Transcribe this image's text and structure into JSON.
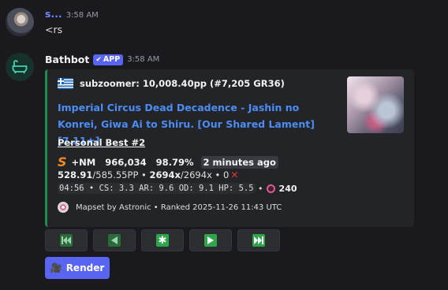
{
  "message1": {
    "username": "s...",
    "time": "3:58 AM",
    "text": "<rs"
  },
  "message2": {
    "username": "Bathbot",
    "badge": "APP",
    "time": "3:58 AM"
  },
  "embed": {
    "accent_color": "#1f8b4c",
    "author": "subzoomer: 10,008.40pp (#7,205 GR36)",
    "title": "Imperial Circus Dead Decadence - Jashin no Konrei, Giwa Ai to Shiru. [Our Shared Lament] [7.11★]",
    "personal_best": "Personal Best #2",
    "grade": "S",
    "mods": "+NM",
    "score": "966,034",
    "accuracy": "98.79%",
    "time_ago": "2 minutes ago",
    "pp_value": "528.91",
    "pp_max": "/585.55PP",
    "combo": "2694x",
    "max_combo": "/2694x",
    "misses": "0",
    "map_stats": "04:56 • CS: 3.3 AR: 9.6 OD: 9.1 HP: 5.5",
    "circle_count": "240",
    "footer": "Mapset by Astronic • Ranked 2025-11-26 11:43 UTC"
  },
  "buttons": [
    {
      "name": "first-page",
      "icon": "skip-back-icon"
    },
    {
      "name": "previous-page",
      "icon": "play-left-icon"
    },
    {
      "name": "jump-page",
      "icon": "asterisk-icon"
    },
    {
      "name": "next-page",
      "icon": "play-right-icon"
    },
    {
      "name": "last-page",
      "icon": "skip-forward-icon"
    }
  ],
  "render_button": {
    "label": "Render"
  }
}
